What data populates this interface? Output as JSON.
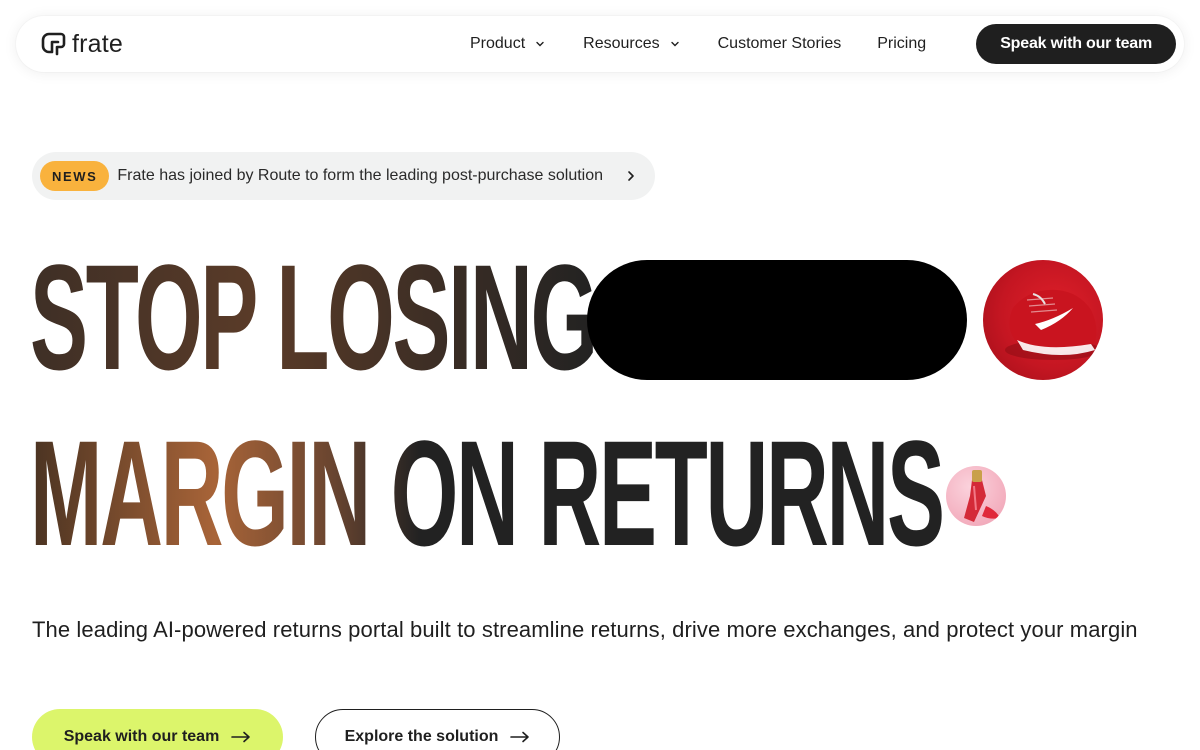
{
  "brand": {
    "name": "frate"
  },
  "nav": {
    "links": [
      {
        "label": "Product",
        "has_dropdown": true
      },
      {
        "label": "Resources",
        "has_dropdown": true
      },
      {
        "label": "Customer Stories",
        "has_dropdown": false
      },
      {
        "label": "Pricing",
        "has_dropdown": false
      }
    ],
    "cta_label": "Speak with our team"
  },
  "news": {
    "badge": "NEWS",
    "text": "Frate has joined by Route to form the leading post-purchase solution",
    "icon": "chevron-right-icon"
  },
  "hero": {
    "line1": "STOP LOSING",
    "line2a": "MARGIN ON",
    "line2b": "RETURNS",
    "subtext": "The leading AI-powered returns portal built to streamline returns, drive more exchanges, and protect your margin",
    "images": [
      "red-sneaker-image",
      "pink-lip-gloss-image"
    ]
  },
  "cta": {
    "primary_label": "Speak with our team",
    "secondary_label": "Explore the solution",
    "icon": "arrow-right-icon"
  },
  "colors": {
    "nav_cta_bg": "#1f1f1f",
    "badge_bg": "#f9b23d",
    "primary_btn_bg": "#dcf56b",
    "headline_gradient_accent": "#a86438"
  }
}
